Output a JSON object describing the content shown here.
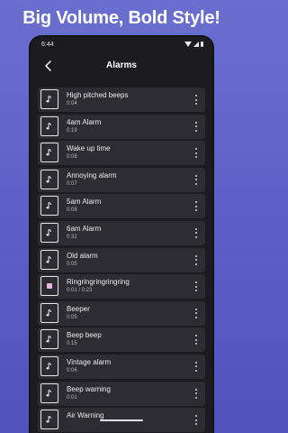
{
  "promo": {
    "title": "Big Volume, Bold Style!"
  },
  "status_bar": {
    "time": "6:44"
  },
  "app_bar": {
    "title": "Alarms"
  },
  "alarms": [
    {
      "title": "High pitched beeps",
      "duration": "0:04",
      "state": "idle",
      "icon": "music-note-icon"
    },
    {
      "title": "4am Alarm",
      "duration": "0:19",
      "state": "idle",
      "icon": "music-note-icon"
    },
    {
      "title": "Wake up time",
      "duration": "0:08",
      "state": "idle",
      "icon": "music-note-icon"
    },
    {
      "title": "Annoying alarm",
      "duration": "0:07",
      "state": "idle",
      "icon": "music-note-icon"
    },
    {
      "title": "5am Alarm",
      "duration": "0:08",
      "state": "idle",
      "icon": "music-note-icon"
    },
    {
      "title": "6am Alarm",
      "duration": "0:32",
      "state": "idle",
      "icon": "music-note-icon"
    },
    {
      "title": "Old alarm",
      "duration": "0:05",
      "state": "idle",
      "icon": "music-note-icon"
    },
    {
      "title": "Ringringringringring",
      "duration": "0:01 / 0:23",
      "state": "playing",
      "icon": "stop-icon"
    },
    {
      "title": "Beeper",
      "duration": "0:05",
      "state": "idle",
      "icon": "music-note-icon"
    },
    {
      "title": "Beep beep",
      "duration": "0:15",
      "state": "idle",
      "icon": "music-note-icon"
    },
    {
      "title": "Vintage alarm",
      "duration": "0:06",
      "state": "idle",
      "icon": "music-note-icon"
    },
    {
      "title": "Beep warning",
      "duration": "0:01",
      "state": "idle",
      "icon": "music-note-icon"
    },
    {
      "title": "Air Warning",
      "duration": "",
      "state": "idle",
      "icon": "music-note-icon"
    }
  ],
  "colors": {
    "background_gradient_top": "#6a6fcf",
    "phone_background": "#1c1b1f",
    "row_background": "#2e2c33",
    "playing_accent": "#e7b6e3"
  }
}
